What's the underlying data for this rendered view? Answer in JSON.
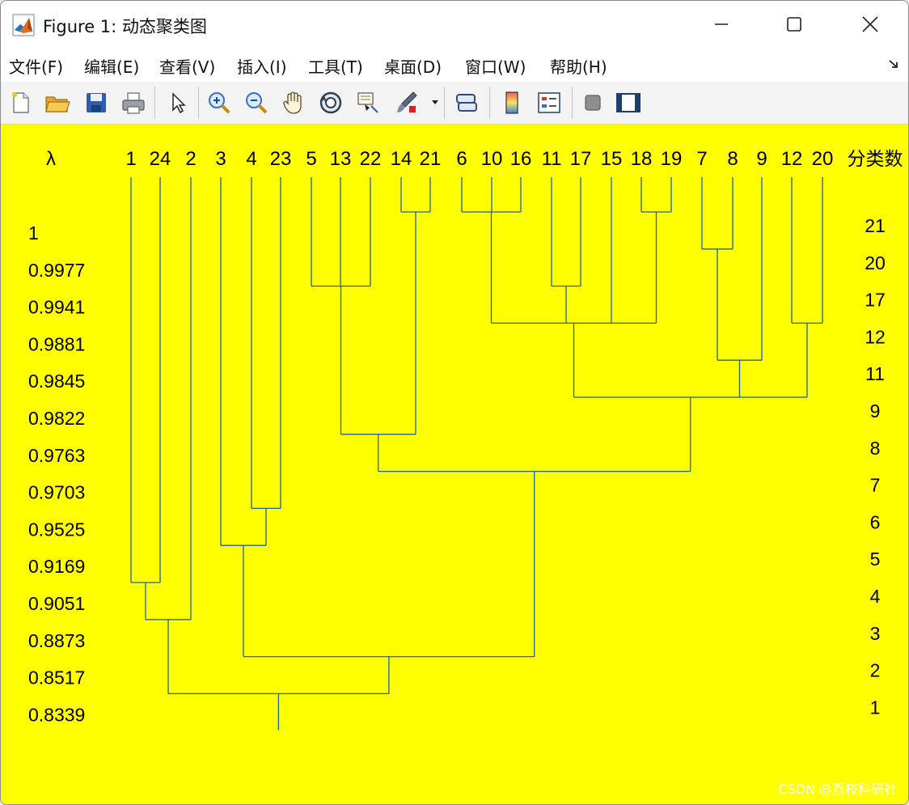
{
  "window": {
    "title": "Figure 1: 动态聚类图",
    "controls": [
      "minimize",
      "maximize",
      "close"
    ]
  },
  "menu": {
    "items": [
      "文件(F)",
      "编辑(E)",
      "查看(V)",
      "插入(I)",
      "工具(T)",
      "桌面(D)",
      "窗口(W)",
      "帮助(H)"
    ]
  },
  "toolbar": {
    "buttons": [
      "new-file-icon",
      "open-folder-icon",
      "save-icon",
      "print-icon",
      "pointer-icon",
      "zoom-in-icon",
      "zoom-out-icon",
      "pan-hand-icon",
      "rotate-3d-icon",
      "data-cursor-icon",
      "brush-icon",
      "link-plot-icon",
      "colorbar-icon",
      "legend-icon",
      "hide-plot-tools-icon",
      "show-plot-tools-icon"
    ]
  },
  "chart_data": {
    "type": "dendrogram",
    "lambda_header": "λ",
    "count_header": "分类数",
    "leaf_labels": [
      "1",
      "24",
      "2",
      "3",
      "4",
      "23",
      "5",
      "13",
      "22",
      "14",
      "21",
      "6",
      "10",
      "16",
      "11",
      "17",
      "15",
      "18",
      "19",
      "7",
      "8",
      "9",
      "12",
      "20"
    ],
    "lambda_levels": [
      "1",
      "0.9977",
      "0.9941",
      "0.9881",
      "0.9845",
      "0.9822",
      "0.9763",
      "0.9703",
      "0.9525",
      "0.9169",
      "0.9051",
      "0.8873",
      "0.8517",
      "0.8339"
    ],
    "class_counts": [
      "21",
      "20",
      "17",
      "12",
      "11",
      "9",
      "8",
      "7",
      "6",
      "5",
      "4",
      "3",
      "2",
      "1"
    ],
    "line_color": "#1f5fa0",
    "background_color": "#ffff00",
    "merges": [
      {
        "members": [
          "14",
          "21"
        ],
        "lambda": "1"
      },
      {
        "members": [
          "6",
          "10",
          "16"
        ],
        "lambda": "1"
      },
      {
        "members": [
          "18",
          "19"
        ],
        "lambda": "1"
      },
      {
        "members": [
          "7",
          "8"
        ],
        "lambda": "0.9977"
      },
      {
        "members": [
          "5",
          "13",
          "22"
        ],
        "lambda": "0.9941"
      },
      {
        "members": [
          "11",
          "17"
        ],
        "lambda": "0.9941"
      },
      {
        "members": [
          "6",
          "10",
          "16",
          "11",
          "17",
          "15",
          "18",
          "19"
        ],
        "lambda": "0.9881"
      },
      {
        "members": [
          "12",
          "20"
        ],
        "lambda": "0.9881"
      },
      {
        "members": [
          "7",
          "8",
          "9"
        ],
        "lambda": "0.9845"
      },
      {
        "members": [
          "6",
          "10",
          "16",
          "11",
          "17",
          "15",
          "18",
          "19",
          "7",
          "8",
          "9",
          "12",
          "20"
        ],
        "lambda": "0.9822"
      },
      {
        "members": [
          "5",
          "13",
          "22",
          "14",
          "21"
        ],
        "lambda": "0.9763"
      },
      {
        "members": [
          "5",
          "13",
          "22",
          "14",
          "21",
          "6",
          "10",
          "16",
          "11",
          "17",
          "15",
          "18",
          "19",
          "7",
          "8",
          "9",
          "12",
          "20"
        ],
        "lambda": "0.9703"
      },
      {
        "members": [
          "4",
          "23"
        ],
        "lambda": "0.9525"
      },
      {
        "members": [
          "3",
          "4",
          "23"
        ],
        "lambda": "0.9169"
      },
      {
        "members": [
          "1",
          "24"
        ],
        "lambda": "0.9051"
      },
      {
        "members": [
          "1",
          "24",
          "2"
        ],
        "lambda": "0.8873"
      },
      {
        "members": [
          "3",
          "4",
          "23",
          "5",
          "13",
          "22",
          "14",
          "21",
          "6",
          "10",
          "16",
          "11",
          "17",
          "15",
          "18",
          "19",
          "7",
          "8",
          "9",
          "12",
          "20"
        ],
        "lambda": "0.8517"
      },
      {
        "members": [
          "1",
          "24",
          "2",
          "3",
          "4",
          "23",
          "5",
          "13",
          "22",
          "14",
          "21",
          "6",
          "10",
          "16",
          "11",
          "17",
          "15",
          "18",
          "19",
          "7",
          "8",
          "9",
          "12",
          "20"
        ],
        "lambda": "0.8339"
      }
    ]
  },
  "watermark": "CSDN @荔枝科研社"
}
